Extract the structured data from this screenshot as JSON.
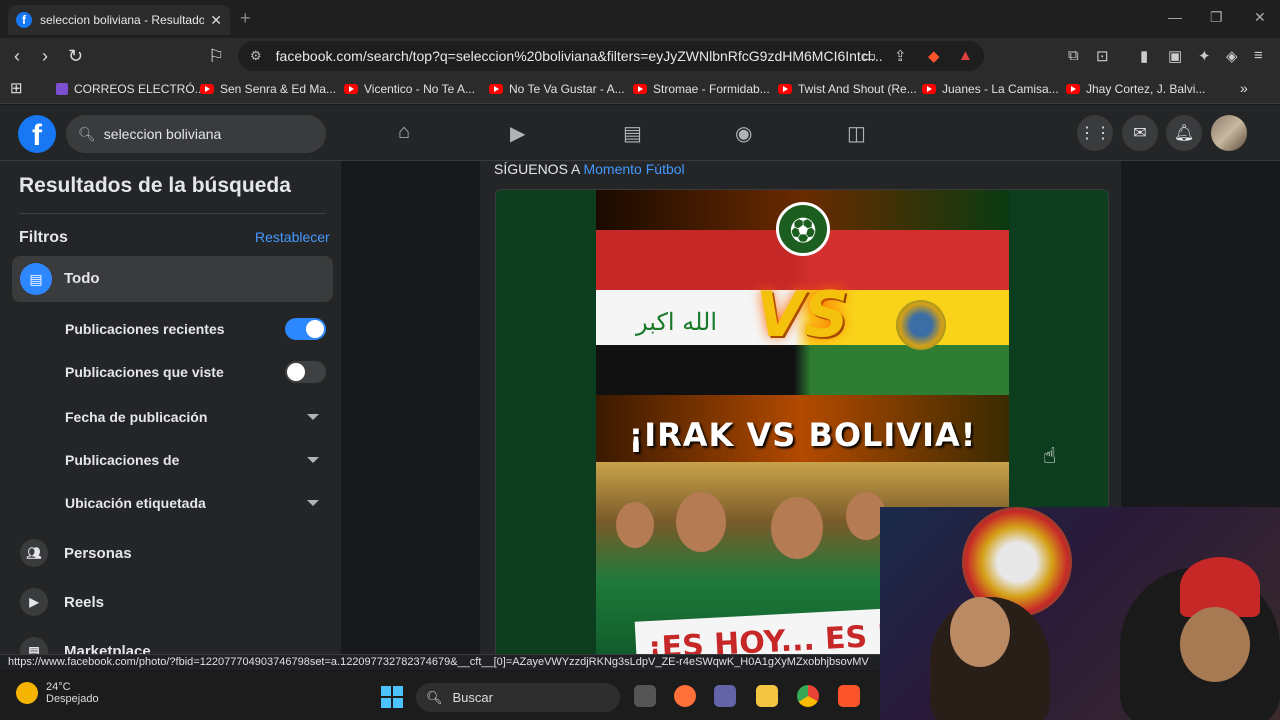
{
  "browser": {
    "tab_title": "seleccion boliviana - Resultados",
    "url": "facebook.com/search/top?q=seleccion%20boliviana&filters=eyJyZWNlbnRfcG9zdHM6MCI6Intcl...",
    "bookmarks": [
      "CORREOS ELECTRÓ...",
      "Sen Senra & Ed Ma...",
      "Vicentico - No Te A...",
      "No Te Va Gustar - A...",
      "Stromae - Formidab...",
      "Twist And Shout (Re...",
      "Juanes - La Camisa...",
      "Jhay Cortez, J. Balvi..."
    ],
    "status_url": "https://www.facebook.com/photo/?fbid=122077704903746798set=a.122097732782374679&__cft__[0]=AZayeVWYzzdjRKNg3sLdpV_ZE-r4eSWqwK_H0A1gXyMZxobhjbsovMV"
  },
  "header": {
    "search_value": "seleccion boliviana",
    "nav_icons": [
      "home-icon",
      "video-icon",
      "marketplace-icon",
      "groups-icon",
      "gaming-icon"
    ],
    "right_icons": [
      "menu-grid-icon",
      "messenger-icon",
      "notifications-icon"
    ]
  },
  "sidebar": {
    "title": "Resultados de la búsqueda",
    "filters_label": "Filtros",
    "reset_label": "Restablecer",
    "todo_label": "Todo",
    "options": {
      "recent": {
        "label": "Publicaciones recientes",
        "on": true
      },
      "seen": {
        "label": "Publicaciones que viste",
        "on": false
      },
      "date": "Fecha de publicación",
      "from": "Publicaciones de",
      "location": "Ubicación etiquetada"
    },
    "categories": [
      "Personas",
      "Reels",
      "Marketplace"
    ]
  },
  "post": {
    "follow_prefix": "SÍGUENOS A",
    "page_name": "Momento Fútbol",
    "headline": "¡IRAK VS BOLIVIA!",
    "vs_text": "VS",
    "arabic_text": "الله اكبر",
    "banner_text": "¡ES HOY... ES H"
  },
  "taskbar": {
    "temperature": "24°C",
    "weather": "Despejado",
    "search_placeholder": "Buscar"
  },
  "colors": {
    "facebook_blue": "#1877f2",
    "link_blue": "#4599ff",
    "toggle_on": "#2d88ff",
    "toggle_off": "#3e4042"
  }
}
